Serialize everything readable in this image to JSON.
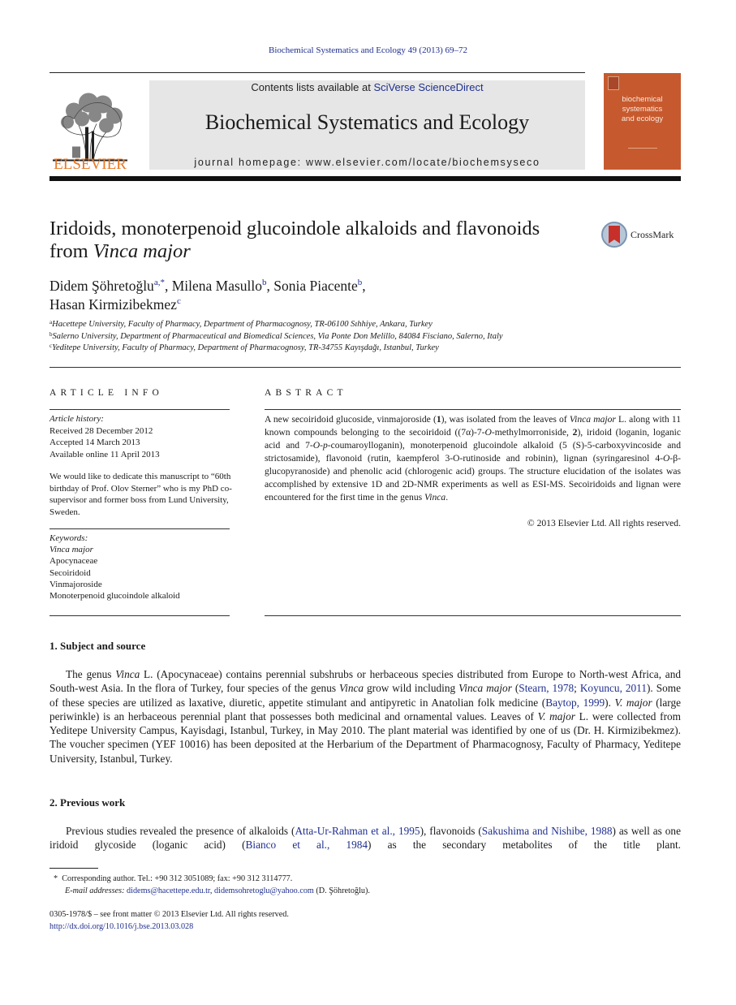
{
  "running_header": "Biochemical Systematics and Ecology 49 (2013) 69–72",
  "masthead": {
    "publisher_logo_text": "ELSEVIER",
    "contents_prefix": "Contents lists available at ",
    "contents_link": "SciVerse ScienceDirect",
    "journal_title": "Biochemical Systematics and Ecology",
    "homepage_prefix": "journal homepage: ",
    "homepage_url": "www.elsevier.com/locate/biochemsyseco",
    "cover": {
      "title_lines": [
        "biochemical",
        "systematics",
        "and ecology"
      ],
      "color": "#c65a2e"
    }
  },
  "colors": {
    "link": "#1f2f8f",
    "elsevier_orange": "#e87722",
    "masthead_gray": "#e6e6e6"
  },
  "article": {
    "title_line1": "Iridoids, monoterpenoid glucoindole alkaloids and flavonoids",
    "title_line2_prefix": "from ",
    "title_line2_italic": "Vinca major",
    "crossmark_label": "CrossMark",
    "authors": [
      {
        "name": "Didem Şöhretoğlu",
        "sup": "a,",
        "star": "*",
        "sep": ", "
      },
      {
        "name": "Milena Masullo",
        "sup": "b",
        "sep": ", "
      },
      {
        "name": "Sonia Piacente",
        "sup": "b",
        "sep": ","
      },
      {
        "name": "Hasan Kirmizibekmez",
        "sup": "c",
        "sep": ""
      }
    ],
    "affiliations": [
      {
        "mark": "a",
        "text": "Hacettepe University, Faculty of Pharmacy, Department of Pharmacognosy, TR-06100 Sıhhiye, Ankara, Turkey"
      },
      {
        "mark": "b",
        "text": "Salerno University, Department of Pharmaceutical and Biomedical Sciences, Via Ponte Don Melillo, 84084 Fisciano, Salerno, Italy"
      },
      {
        "mark": "c",
        "text": "Yeditepe University, Faculty of Pharmacy, Department of Pharmacognosy, TR-34755 Kayışdağı, Istanbul, Turkey"
      }
    ]
  },
  "article_info": {
    "heading": "ARTICLE INFO",
    "history_label": "Article history:",
    "received": "Received 28 December 2012",
    "accepted": "Accepted 14 March 2013",
    "available": "Available online 11 April 2013",
    "dedication": "We would like to dedicate this manuscript to “60th birthday of Prof. Olov Sterner” who is my PhD co-supervisor and former boss from Lund University, Sweden.",
    "keywords_label": "Keywords:",
    "keywords": [
      "Vinca major",
      "Apocynaceae",
      "Secoiridoid",
      "Vinmajoroside",
      "Monoterpenoid glucoindole alkaloid"
    ]
  },
  "abstract": {
    "heading": "ABSTRACT",
    "parts": [
      {
        "t": "A new secoiridoid glucoside, vinmajoroside ("
      },
      {
        "t": "1",
        "s": "b"
      },
      {
        "t": "), was isolated from the leaves of "
      },
      {
        "t": "Vinca major",
        "s": "i"
      },
      {
        "t": " L. along with 11 known compounds belonging to the secoiridoid ((7α)-7-"
      },
      {
        "t": "O",
        "s": "i"
      },
      {
        "t": "-methylmorroniside, "
      },
      {
        "t": "2",
        "s": "b"
      },
      {
        "t": "), iridoid (loganin, loganic acid and 7-"
      },
      {
        "t": "O",
        "s": "i"
      },
      {
        "t": "-"
      },
      {
        "t": "p",
        "s": "i"
      },
      {
        "t": "-coumaroylloganin), monoterpenoid glucoindole alkaloid (5 (S)-5-carboxyvincoside and strictosamide), flavonoid (rutin, kaempferol 3-O-rutinoside and robinin), lignan (syringaresinol 4-"
      },
      {
        "t": "O",
        "s": "i"
      },
      {
        "t": "-β-glucopyranoside) and phenolic acid (chlorogenic acid) groups. The structure elucidation of the isolates was accomplished by extensive 1D and 2D-NMR experiments as well as ESI-MS. Secoiridoids and lignan were encountered for the first time in the genus "
      },
      {
        "t": "Vinca",
        "s": "i"
      },
      {
        "t": "."
      }
    ],
    "copyright": "© 2013 Elsevier Ltd. All rights reserved."
  },
  "sections": [
    {
      "heading": "1.  Subject and source",
      "parts": [
        {
          "t": "The genus "
        },
        {
          "t": "Vinca",
          "s": "i"
        },
        {
          "t": " L. (Apocynaceae) contains perennial subshrubs or herbaceous species distributed from Europe to North-west Africa, and South-west Asia. In the flora of Turkey, four species of the genus "
        },
        {
          "t": "Vinca",
          "s": "i"
        },
        {
          "t": " grow wild including "
        },
        {
          "t": "Vinca major",
          "s": "i"
        },
        {
          "t": " ("
        },
        {
          "t": "Stearn, 1978",
          "s": "l"
        },
        {
          "t": "; "
        },
        {
          "t": "Koyuncu, 2011",
          "s": "l"
        },
        {
          "t": "). Some of these species are utilized as laxative, diuretic, appetite stimulant and antipyretic in Anatolian folk medicine ("
        },
        {
          "t": "Baytop, 1999",
          "s": "l"
        },
        {
          "t": "). "
        },
        {
          "t": "V. major",
          "s": "i"
        },
        {
          "t": " (large periwinkle) is an herbaceous perennial plant that possesses both medicinal and ornamental values. Leaves of "
        },
        {
          "t": "V. major",
          "s": "i"
        },
        {
          "t": " L. were collected from Yeditepe University Campus, Kayisdagi, Istanbul, Turkey, in May 2010. The plant material was identified by one of us (Dr. H. Kirmizibekmez). The voucher specimen (YEF 10016) has been deposited at the Herbarium of the Department of Pharmacognosy, Faculty of Pharmacy, Yeditepe University, Istanbul, Turkey."
        }
      ]
    },
    {
      "heading": "2.  Previous work",
      "parts": [
        {
          "t": "Previous studies revealed the presence of alkaloids ("
        },
        {
          "t": "Atta-Ur-Rahman et al., 1995",
          "s": "l"
        },
        {
          "t": "), flavonoids ("
        },
        {
          "t": "Sakushima and Nishibe, 1988",
          "s": "l"
        },
        {
          "t": ") as well as one iridoid glycoside (loganic acid) ("
        },
        {
          "t": "Bianco et al., 1984",
          "s": "l"
        },
        {
          "t": ") as the secondary metabolites of the title plant."
        }
      ]
    }
  ],
  "footnotes": {
    "corresponding_star": "*",
    "corresponding": "Corresponding author. Tel.: +90 312 3051089; fax: +90 312 3114777.",
    "email_label": "E-mail addresses: ",
    "email1": "didems@hacettepe.edu.tr",
    "email_sep": ", ",
    "email2": "didemsohretoglu@yahoo.com",
    "email_owner": " (D. Şöhretoğlu).",
    "front_matter": "0305-1978/$ – see front matter © 2013 Elsevier Ltd. All rights reserved.",
    "doi": "http://dx.doi.org/10.1016/j.bse.2013.03.028"
  }
}
